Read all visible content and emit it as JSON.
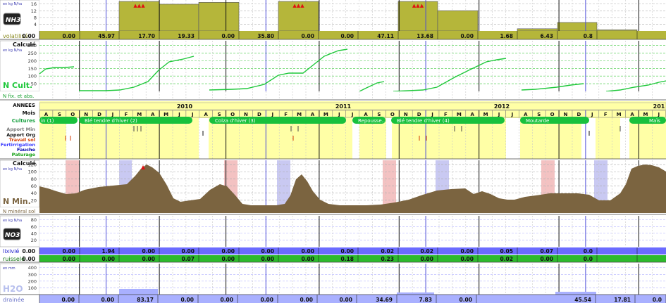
{
  "colors": {
    "nh3_fill": "#b5b63a",
    "nh3_value_bar": "#b5b63a",
    "ncult_line": "#1ec83a",
    "cycle_bg": "#ffffa6",
    "crop_band": "#18c13c",
    "nmin_fill": "#7b6440",
    "nmin_value_bar": "#7b6440",
    "lixivie_bar": "#6b6bff",
    "ruissele_bar": "#2dbb2d",
    "draine_bar": "#a9b0ff",
    "label_lixivie": "#2020cc",
    "label_ruissele": "#107010",
    "label_draine": "#6e76c9",
    "apport_min": "#7a7a7a",
    "apport_org": "#111111",
    "travail_sol": "#d33b00",
    "fertirrigation": "#3a3aff",
    "fauche": "#0000aa",
    "paturage": "#15a015",
    "marker": "#e01010",
    "pink_band": "#f3c2c2",
    "blue_band": "#c9c9f2"
  },
  "nh3": {
    "icon_text": "NH3",
    "unit": "en kg N/ha",
    "ticks": [
      "16",
      "12",
      "8",
      "4"
    ],
    "row_label": "volatilisé",
    "values": [
      "0.00",
      "0.00",
      "45.97",
      "17.70",
      "19.33",
      "0.00",
      "35.80",
      "0.00",
      "0.00",
      "47.11",
      "13.68",
      "0.00",
      "1.68",
      "6.43",
      "0.8"
    ],
    "levels": [
      0,
      0,
      16,
      14.5,
      15.5,
      0,
      16,
      0,
      0,
      16,
      11,
      0,
      1.2,
      4.6,
      0.6
    ],
    "markers": "▲▲▲"
  },
  "ncult": {
    "title": "Calculé",
    "unit": "en kg N/ha",
    "ticks": [
      "300",
      "250",
      "200",
      "150",
      "100",
      "50"
    ],
    "label": "N Cult.",
    "row_label": "N fix. et abs."
  },
  "calendar": {
    "annees_label": "ANNEES",
    "mois_label": "Mois",
    "cultures_label": "Cultures",
    "apport_min": "Apport Min",
    "apport_org": "Apport Org",
    "travail_sol": "Travail sol",
    "fertirrigation": "Fertirrigation",
    "fauche": "Fauche",
    "paturage": "Paturage",
    "years": [
      "2010",
      "2011",
      "2012",
      "201"
    ],
    "months": [
      "A",
      "S",
      "O",
      "N",
      "D",
      "J",
      "F",
      "M",
      "A",
      "M",
      "J",
      "J",
      "A",
      "S",
      "O",
      "N",
      "D",
      "J",
      "F",
      "M",
      "A",
      "M",
      "J",
      "J",
      "A",
      "S",
      "O",
      "N",
      "D",
      "J",
      "F",
      "M",
      "A",
      "M",
      "J",
      "J",
      "A",
      "S",
      "O",
      "N",
      "D",
      "J",
      "F",
      "M",
      "A",
      "M",
      "J"
    ],
    "crops": [
      "in (1)",
      "Blé tendre d'hiver (2)",
      "Colza d'hiver (3)",
      "Repousse...",
      "Blé tendre d'hiver (4)",
      "Moutarde",
      "Maïs"
    ]
  },
  "nmin": {
    "title": "Calculé",
    "unit": "en kg N/ha",
    "ticks": [
      "120",
      "100",
      "80",
      "60",
      "40",
      "20"
    ],
    "label": "N Min.",
    "row_label": "N minéral sol"
  },
  "no3": {
    "icon_text": "NO3",
    "unit": "en kg N/ha",
    "ticks": [
      "80",
      "60",
      "40",
      "20"
    ],
    "lixivie_label": "lixivié",
    "ruissele_label": "ruisselé",
    "lixivie_values": [
      "0.00",
      "0.00",
      "1.94",
      "0.00",
      "0.00",
      "0.00",
      "0.00",
      "0.00",
      "0.00",
      "0.02",
      "0.02",
      "0.00",
      "0.05",
      "0.07",
      "0.0"
    ],
    "ruissele_values": [
      "0.00",
      "0.00",
      "0.00",
      "0.00",
      "0.07",
      "0.00",
      "0.00",
      "0.00",
      "0.18",
      "0.23",
      "0.00",
      "0.00",
      "0.02",
      "0.00",
      "0.0"
    ]
  },
  "h2o": {
    "icon_text": "H2O",
    "unit": "en mm",
    "ticks": [
      "400",
      "300",
      "200",
      "100"
    ],
    "row_label": "drainée",
    "values": [
      "0.00",
      "0.00",
      "83.17",
      "0.00",
      "0.00",
      "0.00",
      "0.00",
      "0.00",
      "34.69",
      "7.83",
      "0.00",
      "45.54",
      "17.81",
      "0.0"
    ]
  }
}
